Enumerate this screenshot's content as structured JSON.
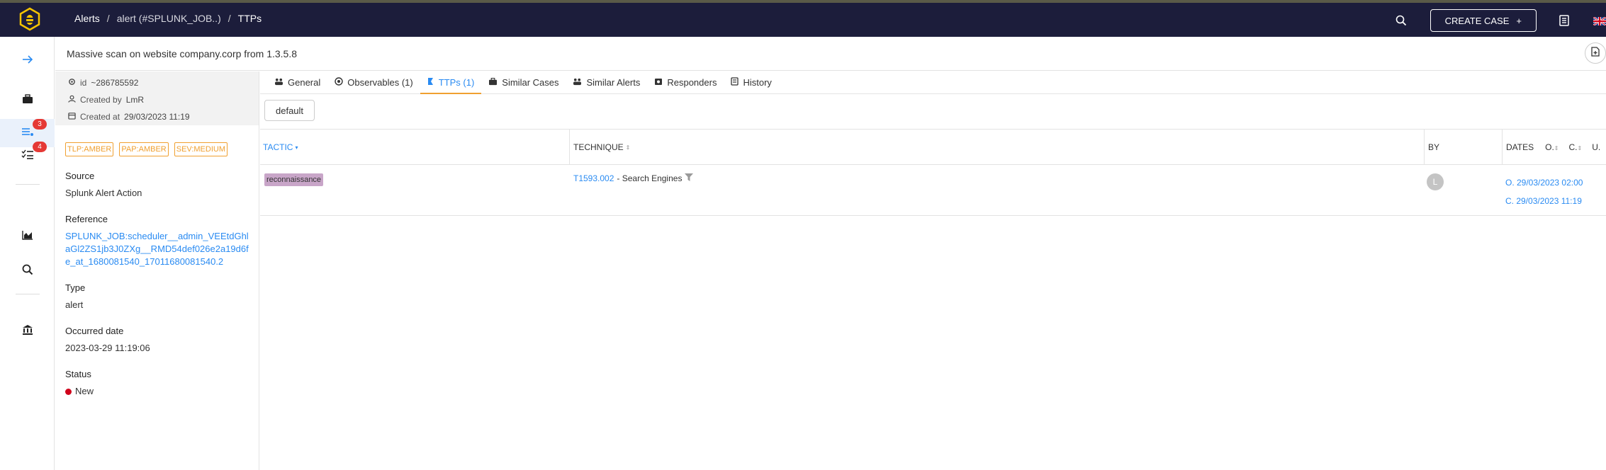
{
  "breadcrumb": {
    "alerts": "Alerts",
    "alert": "alert (#SPLUNK_JOB..)",
    "current": "TTPs"
  },
  "header": {
    "create_case": "CREATE CASE"
  },
  "sidebar": {
    "alerts_badge": "3",
    "tasks_badge": "4"
  },
  "alert": {
    "title": "Massive scan on website company.corp from 1.3.5.8",
    "id_label": "id",
    "id_value": "~286785592",
    "created_by_label": "Created by",
    "created_by_value": "LmR",
    "created_at_label": "Created at",
    "created_at_value": "29/03/2023 11:19",
    "tags": [
      "TLP:AMBER",
      "PAP:AMBER",
      "SEV:MEDIUM"
    ],
    "source_label": "Source",
    "source_value": "Splunk Alert Action",
    "reference_label": "Reference",
    "reference_value": "SPLUNK_JOB:scheduler__admin_VEEtdGhlaGl2ZS1jb3J0ZXg__RMD54def026e2a19d6fe_at_1680081540_17011680081540.2",
    "type_label": "Type",
    "type_value": "alert",
    "occurred_label": "Occurred date",
    "occurred_value": "2023-03-29 11:19:06",
    "status_label": "Status",
    "status_value": "New"
  },
  "tabs": [
    {
      "label": "General",
      "icon": "general-icon"
    },
    {
      "label": "Observables (1)",
      "icon": "observables-icon"
    },
    {
      "label": "TTPs (1)",
      "icon": "ttp-icon"
    },
    {
      "label": "Similar Cases",
      "icon": "cases-icon"
    },
    {
      "label": "Similar Alerts",
      "icon": "alerts-icon"
    },
    {
      "label": "Responders",
      "icon": "responders-icon"
    },
    {
      "label": "History",
      "icon": "history-icon"
    }
  ],
  "ttp": {
    "filter_button": "default",
    "columns": {
      "tactic": "TACTIC",
      "technique": "TECHNIQUE",
      "by": "BY",
      "dates": "DATES",
      "o": "O.",
      "c": "C.",
      "u": "U."
    },
    "rows": [
      {
        "tactic": "reconnaissance",
        "technique_id": "T1593.002",
        "technique_name": "- Search Engines",
        "by_initial": "L",
        "occurred": "O. 29/03/2023 02:00",
        "created": "C. 29/03/2023 11:19"
      }
    ]
  },
  "colors": {
    "topbar": "#1c1d3b",
    "accent": "#2a8bf2",
    "tag": "#f0a030",
    "tactic_bg": "#c8a5c8",
    "badge": "#e53935"
  }
}
